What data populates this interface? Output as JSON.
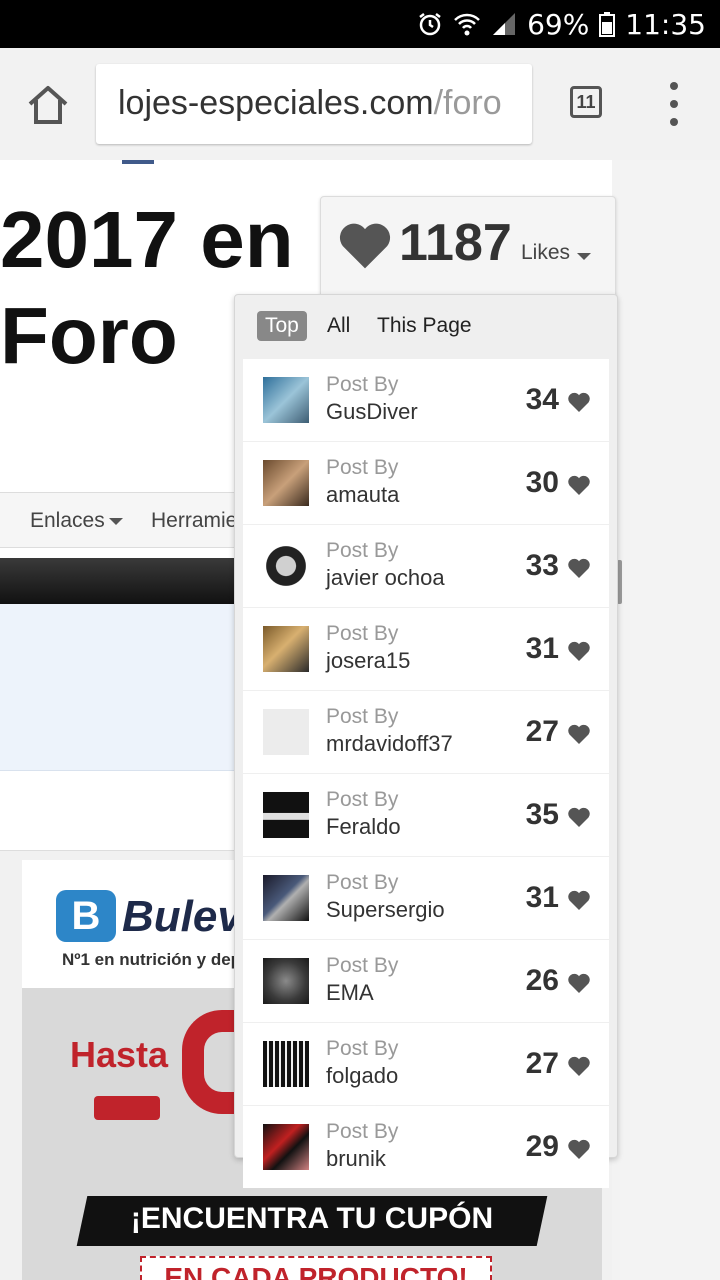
{
  "status_bar": {
    "battery": "69%",
    "time": "11:35",
    "icons": [
      "alarm-icon",
      "wifi-icon",
      "signal-icon",
      "battery-icon"
    ]
  },
  "browser": {
    "url_main": "lojes-especiales.com",
    "url_path": "/foro",
    "tab_count": "11"
  },
  "page": {
    "headline_line1": "2017 en",
    "headline_line2": "Foro",
    "nav": {
      "enlaces": "Enlaces",
      "herramientas": "Herramie"
    }
  },
  "ad": {
    "logo_letter": "B",
    "brand": "Bulev",
    "tagline": "Nº1 en nutrición y dep",
    "hasta": "Hasta",
    "banner": "¡ENCUENTRA TU CUPÓN",
    "bottom": "EN CADA PRODUCTO!"
  },
  "likes": {
    "count": "1187",
    "label": "Likes",
    "tabs": {
      "top": "Top",
      "all": "All",
      "this_page": "This Page"
    },
    "post_by_label": "Post By",
    "items": [
      {
        "user": "GusDiver",
        "count": "34"
      },
      {
        "user": "amauta",
        "count": "30"
      },
      {
        "user": "javier ochoa",
        "count": "33"
      },
      {
        "user": "josera15",
        "count": "31"
      },
      {
        "user": "mrdavidoff37",
        "count": "27"
      },
      {
        "user": "Feraldo",
        "count": "35"
      },
      {
        "user": "Supersergio",
        "count": "31"
      },
      {
        "user": "EMA",
        "count": "26"
      },
      {
        "user": "folgado",
        "count": "27"
      },
      {
        "user": "brunik",
        "count": "29"
      }
    ]
  }
}
